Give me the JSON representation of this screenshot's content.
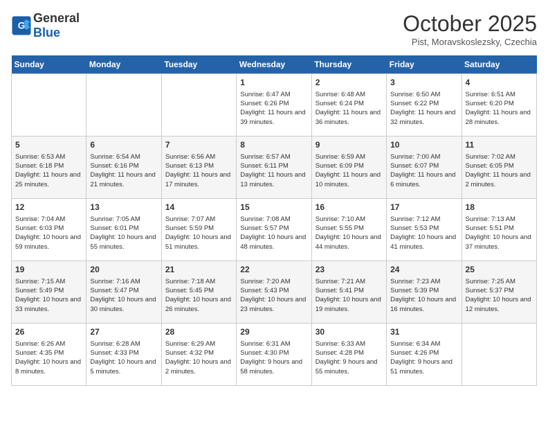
{
  "logo": {
    "general": "General",
    "blue": "Blue"
  },
  "title": "October 2025",
  "subtitle": "Pist, Moravskoslezsky, Czechia",
  "days_of_week": [
    "Sunday",
    "Monday",
    "Tuesday",
    "Wednesday",
    "Thursday",
    "Friday",
    "Saturday"
  ],
  "weeks": [
    [
      {
        "day": "",
        "info": ""
      },
      {
        "day": "",
        "info": ""
      },
      {
        "day": "",
        "info": ""
      },
      {
        "day": "1",
        "info": "Sunrise: 6:47 AM\nSunset: 6:26 PM\nDaylight: 11 hours and 39 minutes."
      },
      {
        "day": "2",
        "info": "Sunrise: 6:48 AM\nSunset: 6:24 PM\nDaylight: 11 hours and 36 minutes."
      },
      {
        "day": "3",
        "info": "Sunrise: 6:50 AM\nSunset: 6:22 PM\nDaylight: 11 hours and 32 minutes."
      },
      {
        "day": "4",
        "info": "Sunrise: 6:51 AM\nSunset: 6:20 PM\nDaylight: 11 hours and 28 minutes."
      }
    ],
    [
      {
        "day": "5",
        "info": "Sunrise: 6:53 AM\nSunset: 6:18 PM\nDaylight: 11 hours and 25 minutes."
      },
      {
        "day": "6",
        "info": "Sunrise: 6:54 AM\nSunset: 6:16 PM\nDaylight: 11 hours and 21 minutes."
      },
      {
        "day": "7",
        "info": "Sunrise: 6:56 AM\nSunset: 6:13 PM\nDaylight: 11 hours and 17 minutes."
      },
      {
        "day": "8",
        "info": "Sunrise: 6:57 AM\nSunset: 6:11 PM\nDaylight: 11 hours and 13 minutes."
      },
      {
        "day": "9",
        "info": "Sunrise: 6:59 AM\nSunset: 6:09 PM\nDaylight: 11 hours and 10 minutes."
      },
      {
        "day": "10",
        "info": "Sunrise: 7:00 AM\nSunset: 6:07 PM\nDaylight: 11 hours and 6 minutes."
      },
      {
        "day": "11",
        "info": "Sunrise: 7:02 AM\nSunset: 6:05 PM\nDaylight: 11 hours and 2 minutes."
      }
    ],
    [
      {
        "day": "12",
        "info": "Sunrise: 7:04 AM\nSunset: 6:03 PM\nDaylight: 10 hours and 59 minutes."
      },
      {
        "day": "13",
        "info": "Sunrise: 7:05 AM\nSunset: 6:01 PM\nDaylight: 10 hours and 55 minutes."
      },
      {
        "day": "14",
        "info": "Sunrise: 7:07 AM\nSunset: 5:59 PM\nDaylight: 10 hours and 51 minutes."
      },
      {
        "day": "15",
        "info": "Sunrise: 7:08 AM\nSunset: 5:57 PM\nDaylight: 10 hours and 48 minutes."
      },
      {
        "day": "16",
        "info": "Sunrise: 7:10 AM\nSunset: 5:55 PM\nDaylight: 10 hours and 44 minutes."
      },
      {
        "day": "17",
        "info": "Sunrise: 7:12 AM\nSunset: 5:53 PM\nDaylight: 10 hours and 41 minutes."
      },
      {
        "day": "18",
        "info": "Sunrise: 7:13 AM\nSunset: 5:51 PM\nDaylight: 10 hours and 37 minutes."
      }
    ],
    [
      {
        "day": "19",
        "info": "Sunrise: 7:15 AM\nSunset: 5:49 PM\nDaylight: 10 hours and 33 minutes."
      },
      {
        "day": "20",
        "info": "Sunrise: 7:16 AM\nSunset: 5:47 PM\nDaylight: 10 hours and 30 minutes."
      },
      {
        "day": "21",
        "info": "Sunrise: 7:18 AM\nSunset: 5:45 PM\nDaylight: 10 hours and 26 minutes."
      },
      {
        "day": "22",
        "info": "Sunrise: 7:20 AM\nSunset: 5:43 PM\nDaylight: 10 hours and 23 minutes."
      },
      {
        "day": "23",
        "info": "Sunrise: 7:21 AM\nSunset: 5:41 PM\nDaylight: 10 hours and 19 minutes."
      },
      {
        "day": "24",
        "info": "Sunrise: 7:23 AM\nSunset: 5:39 PM\nDaylight: 10 hours and 16 minutes."
      },
      {
        "day": "25",
        "info": "Sunrise: 7:25 AM\nSunset: 5:37 PM\nDaylight: 10 hours and 12 minutes."
      }
    ],
    [
      {
        "day": "26",
        "info": "Sunrise: 6:26 AM\nSunset: 4:35 PM\nDaylight: 10 hours and 8 minutes."
      },
      {
        "day": "27",
        "info": "Sunrise: 6:28 AM\nSunset: 4:33 PM\nDaylight: 10 hours and 5 minutes."
      },
      {
        "day": "28",
        "info": "Sunrise: 6:29 AM\nSunset: 4:32 PM\nDaylight: 10 hours and 2 minutes."
      },
      {
        "day": "29",
        "info": "Sunrise: 6:31 AM\nSunset: 4:30 PM\nDaylight: 9 hours and 58 minutes."
      },
      {
        "day": "30",
        "info": "Sunrise: 6:33 AM\nSunset: 4:28 PM\nDaylight: 9 hours and 55 minutes."
      },
      {
        "day": "31",
        "info": "Sunrise: 6:34 AM\nSunset: 4:26 PM\nDaylight: 9 hours and 51 minutes."
      },
      {
        "day": "",
        "info": ""
      }
    ]
  ]
}
